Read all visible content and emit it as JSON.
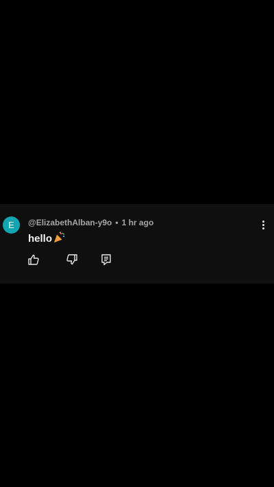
{
  "comment": {
    "avatar_letter": "E",
    "avatar_color": "#12a4b1",
    "author": "@ElizabethAlban-y9o",
    "separator": "•",
    "timestamp": "1 hr ago",
    "text": "hello",
    "emoji": "party-popper-icon"
  },
  "actions": {
    "like_icon": "thumbs-up-icon",
    "dislike_icon": "thumbs-down-icon",
    "reply_icon": "reply-comment-icon",
    "more_icon": "vertical-dots-icon"
  },
  "colors": {
    "background": "#000000",
    "card_background": "#0f0f0f",
    "meta_text": "#a7a7a7",
    "comment_text": "#f1f1f1"
  }
}
